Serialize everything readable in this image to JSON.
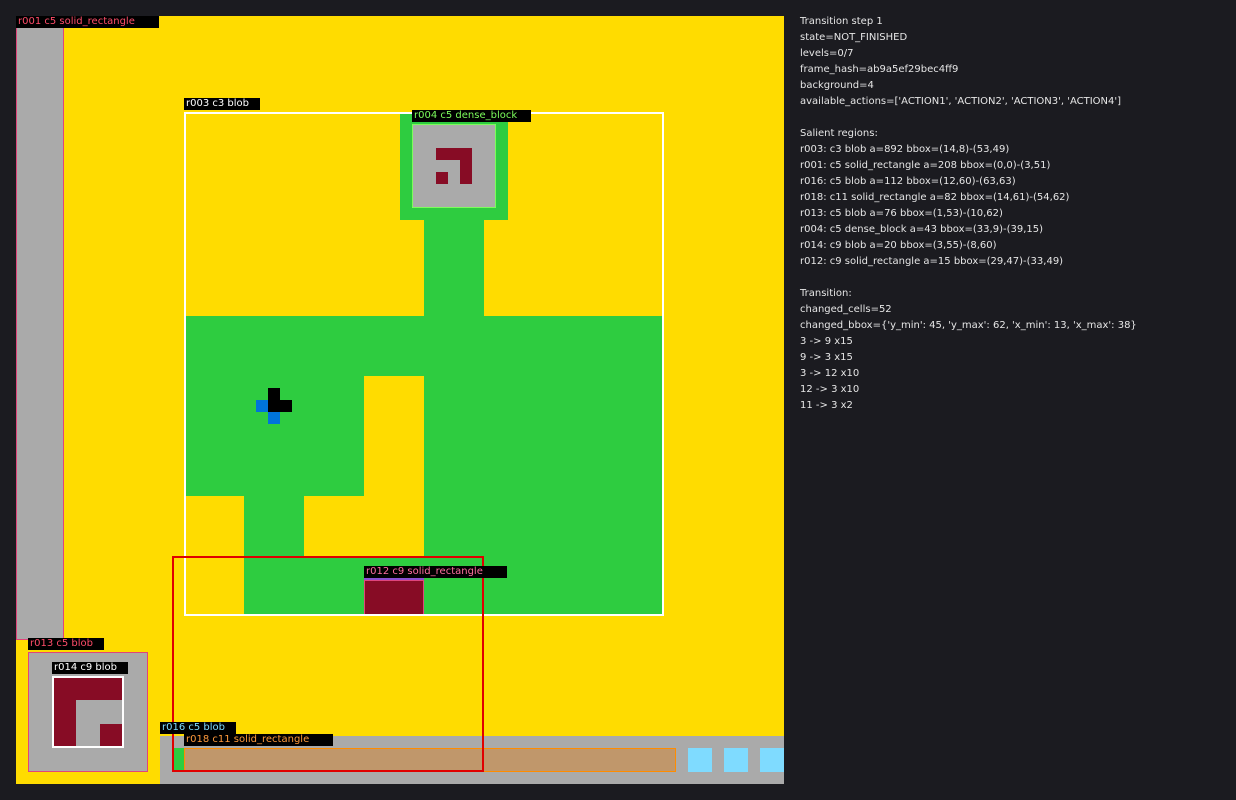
{
  "colors": {
    "background": "#ffdc00",
    "green": "#2ecc40",
    "gray": "#aaaaaa",
    "maroon": "#870c25",
    "black": "#000000",
    "blue": "#0074d9",
    "light_blue": "#7fdbff",
    "tan": "#c0976b",
    "page_bg": "#1b1b20"
  },
  "overlay_labels": {
    "r001": "r001 c5 solid_rectangle",
    "r003": "r003 c3 blob",
    "r004": "r004 c5 dense_block",
    "r012": "r012 c9 solid_rectangle",
    "r013": "r013 c5 blob",
    "r014": "r014 c9 blob",
    "r016": "r016 c5 blob",
    "r018": "r018 c11 solid_rectangle"
  },
  "info": {
    "header": [
      "Transition step 1",
      "state=NOT_FINISHED",
      "levels=0/7",
      "frame_hash=ab9a5ef29bec4ff9",
      "background=4",
      "available_actions=['ACTION1', 'ACTION2', 'ACTION3', 'ACTION4']"
    ],
    "regions_title": "Salient regions:",
    "regions": [
      "r003: c3 blob a=892 bbox=(14,8)-(53,49)",
      "r001: c5 solid_rectangle a=208 bbox=(0,0)-(3,51)",
      "r016: c5 blob a=112 bbox=(12,60)-(63,63)",
      "r018: c11 solid_rectangle a=82 bbox=(14,61)-(54,62)",
      "r013: c5 blob a=76 bbox=(1,53)-(10,62)",
      "r004: c5 dense_block a=43 bbox=(33,9)-(39,15)",
      "r014: c9 blob a=20 bbox=(3,55)-(8,60)",
      "r012: c9 solid_rectangle a=15 bbox=(29,47)-(33,49)"
    ],
    "transition_title": "Transition:",
    "transition": [
      "changed_cells=52",
      "changed_bbox={'y_min': 45, 'y_max': 62, 'x_min': 13, 'x_max': 38}",
      "3 -> 9 x15",
      "9 -> 3 x15",
      "3 -> 12 x10",
      "12 -> 3 x10",
      "11 -> 3 x2"
    ]
  }
}
